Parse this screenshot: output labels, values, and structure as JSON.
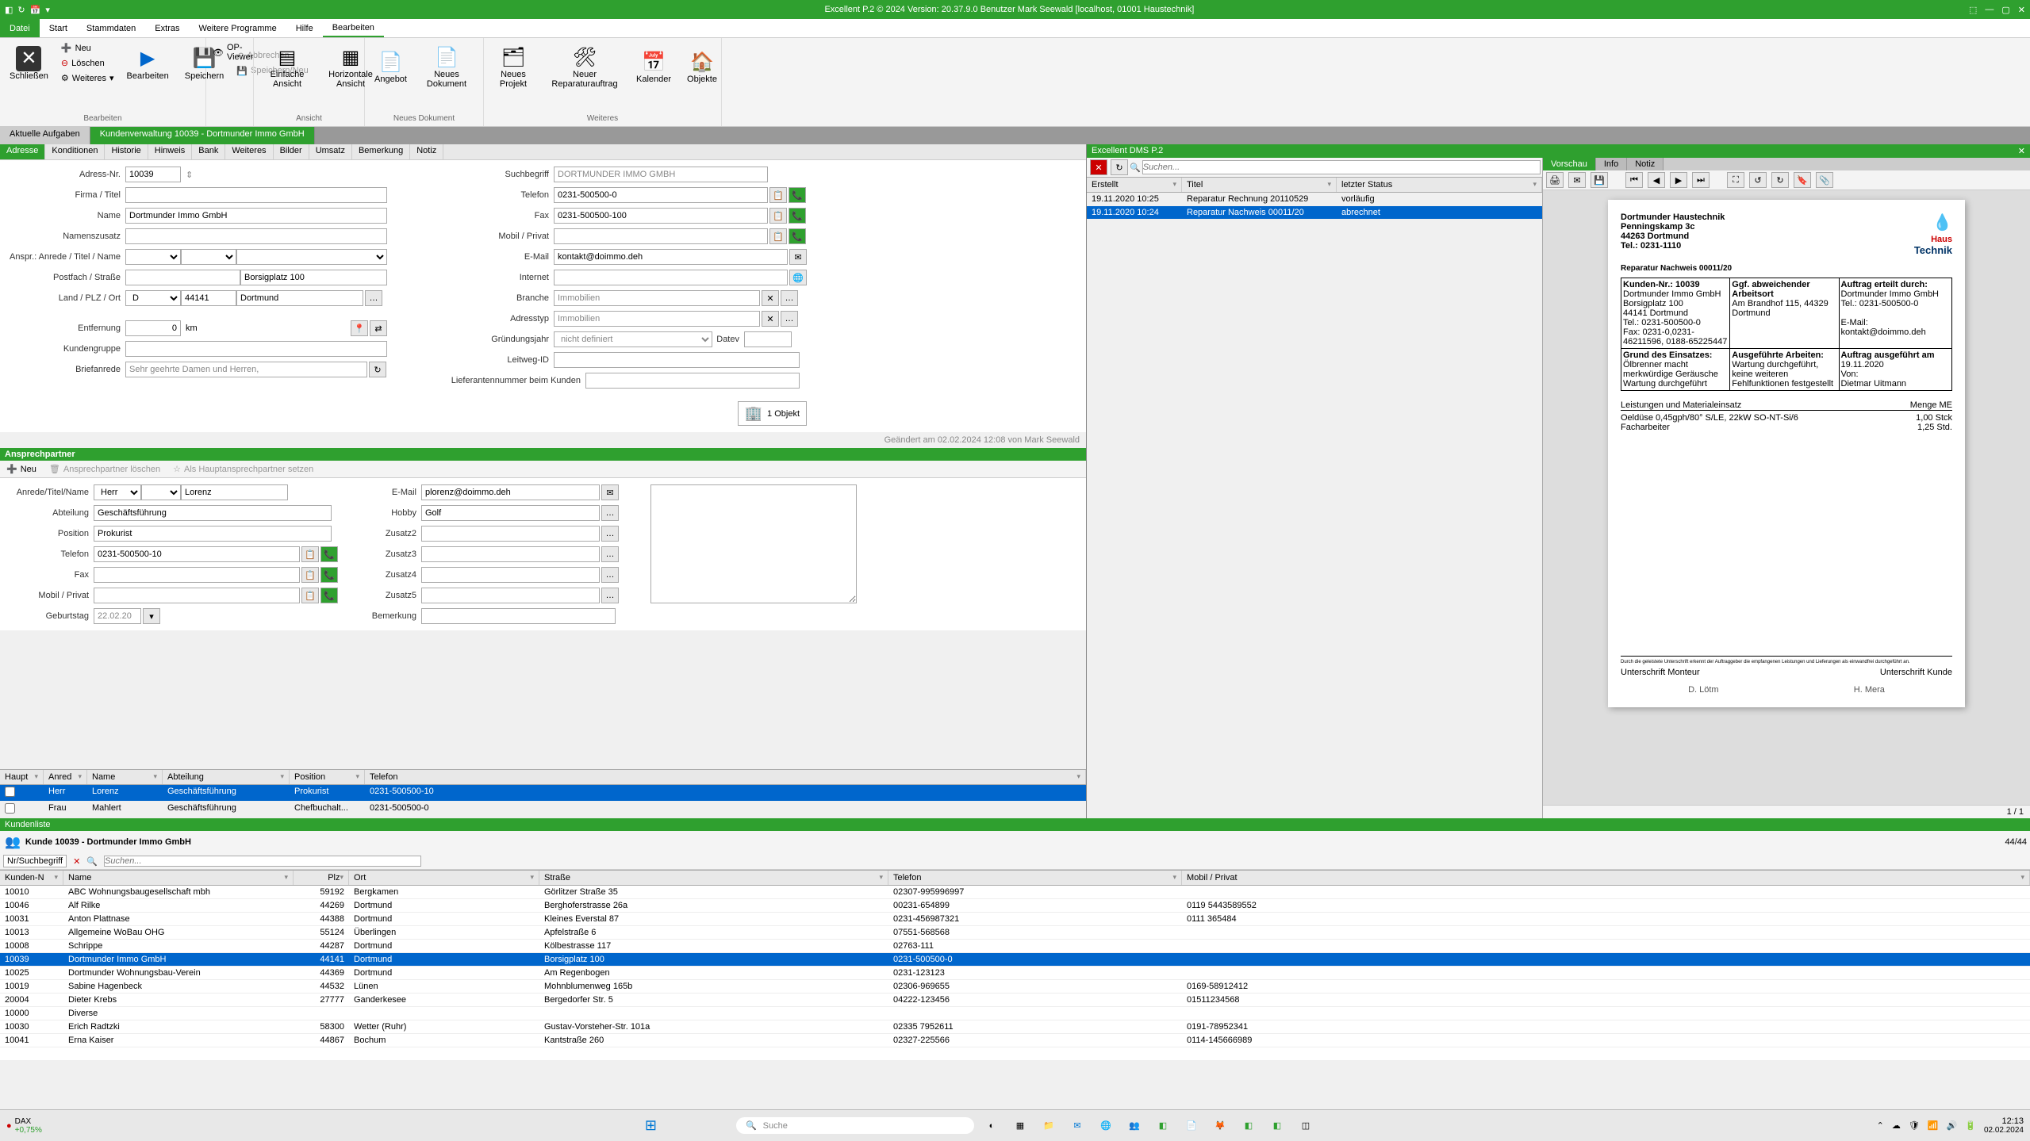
{
  "titlebar": {
    "title": "Excellent P.2 © 2024 Version: 20.37.9.0 Benutzer Mark Seewald [localhost, 01001 Haustechnik]"
  },
  "menu": {
    "datei": "Datei",
    "start": "Start",
    "stammdaten": "Stammdaten",
    "extras": "Extras",
    "weitere_programme": "Weitere Programme",
    "hilfe": "Hilfe",
    "bearbeiten": "Bearbeiten"
  },
  "ribbon": {
    "schliessen": "Schließen",
    "neu": "Neu",
    "loeschen": "Löschen",
    "weiteres": "Weiteres",
    "bearbeiten": "Bearbeiten",
    "speichern": "Speichern",
    "abbrechen": "Abbrechen",
    "speichern_neu": "Speichern/Neu",
    "op_viewer": "OP-Viewer",
    "einfache_ansicht": "Einfache Ansicht",
    "horizontale_ansicht": "Horizontale Ansicht",
    "angebot": "Angebot",
    "neues_dokument": "Neues Dokument",
    "neues_projekt": "Neues Projekt",
    "neuer_reparaturauftrag": "Neuer Reparaturauftrag",
    "kalender": "Kalender",
    "objekte": "Objekte",
    "group_bearbeiten": "Bearbeiten",
    "group_ansicht": "Ansicht",
    "group_neues_dokument": "Neues Dokument",
    "group_weiteres": "Weiteres"
  },
  "doctabs": {
    "aktuelle_aufgaben": "Aktuelle Aufgaben",
    "kundenverwaltung": "Kundenverwaltung 10039 - Dortmunder Immo GmbH"
  },
  "subtabs": {
    "adresse": "Adresse",
    "konditionen": "Konditionen",
    "historie": "Historie",
    "hinweis": "Hinweis",
    "bank": "Bank",
    "weiteres": "Weiteres",
    "bilder": "Bilder",
    "umsatz": "Umsatz",
    "bemerkung": "Bemerkung",
    "notiz": "Notiz"
  },
  "address": {
    "adress_nr_label": "Adress-Nr.",
    "adress_nr": "10039",
    "firma_titel_label": "Firma / Titel",
    "name_label": "Name",
    "name": "Dortmunder Immo GmbH",
    "namenszusatz_label": "Namenszusatz",
    "anspr_label": "Anspr.: Anrede / Titel / Name",
    "postfach_label": "Postfach / Straße",
    "strasse": "Borsigplatz 100",
    "land_plz_ort_label": "Land / PLZ / Ort",
    "land": "D",
    "plz": "44141",
    "ort": "Dortmund",
    "entfernung_label": "Entfernung",
    "entfernung": "0",
    "km": "km",
    "kundengruppe_label": "Kundengruppe",
    "briefanrede_label": "Briefanrede",
    "briefanrede": "Sehr geehrte Damen und Herren,",
    "suchbegriff_label": "Suchbegriff",
    "suchbegriff": "DORTMUNDER IMMO GMBH",
    "telefon_label": "Telefon",
    "telefon": "0231-500500-0",
    "fax_label": "Fax",
    "fax": "0231-500500-100",
    "mobil_label": "Mobil / Privat",
    "email_label": "E-Mail",
    "email": "kontakt@doimmo.deh",
    "internet_label": "Internet",
    "branche_label": "Branche",
    "branche": "Immobilien",
    "adresstyp_label": "Adresstyp",
    "adresstyp": "Immobilien",
    "gruendungsjahr_label": "Gründungsjahr",
    "gruendungsjahr": "nicht definiert",
    "datev_label": "Datev",
    "leitweg_label": "Leitweg-ID",
    "lieferantennr_label": "Lieferantennummer beim Kunden",
    "objekt_count": "1 Objekt",
    "changed": "Geändert am 02.02.2024 12:08 von Mark Seewald"
  },
  "ansprechpartner": {
    "header": "Ansprechpartner",
    "neu": "Neu",
    "loeschen": "Ansprechpartner löschen",
    "haupt": "Als Hauptansprechpartner setzen",
    "anrede_label": "Anrede/Titel/Name",
    "anrede": "Herr",
    "nachname": "Lorenz",
    "abteilung_label": "Abteilung",
    "abteilung": "Geschäftsführung",
    "position_label": "Position",
    "position": "Prokurist",
    "telefon_label": "Telefon",
    "telefon": "0231-500500-10",
    "fax_label": "Fax",
    "mobil_label": "Mobil / Privat",
    "geburtstag_label": "Geburtstag",
    "geburtstag": "22.02.20",
    "email_label": "E-Mail",
    "email": "plorenz@doimmo.deh",
    "hobby_label": "Hobby",
    "hobby": "Golf",
    "zusatz2_label": "Zusatz2",
    "zusatz3_label": "Zusatz3",
    "zusatz4_label": "Zusatz4",
    "zusatz5_label": "Zusatz5",
    "bemerkung_label": "Bemerkung"
  },
  "ap_grid": {
    "h_haupt": "Haupt",
    "h_anrede": "Anred",
    "h_name": "Name",
    "h_abteilung": "Abteilung",
    "h_position": "Position",
    "h_telefon": "Telefon",
    "rows": [
      {
        "anrede": "Herr",
        "name": "Lorenz",
        "abteilung": "Geschäftsführung",
        "position": "Prokurist",
        "telefon": "0231-500500-10"
      },
      {
        "anrede": "Frau",
        "name": "Mahlert",
        "abteilung": "Geschäftsführung",
        "position": "Chefbuchalt...",
        "telefon": "0231-500500-0"
      }
    ]
  },
  "dms": {
    "header": "Excellent DMS P.2",
    "search_placeholder": "Suchen...",
    "h_erstellt": "Erstellt",
    "h_titel": "Titel",
    "h_status": "letzter Status",
    "rows": [
      {
        "erstellt": "19.11.2020 10:25",
        "titel": "Reparatur Rechnung 20110529",
        "status": "vorläufig"
      },
      {
        "erstellt": "19.11.2020 10:24",
        "titel": "Reparatur Nachweis 00011/20",
        "status": "abrechnet"
      }
    ],
    "tab_vorschau": "Vorschau",
    "tab_info": "Info",
    "tab_notiz": "Notiz",
    "page_info": "1 / 1"
  },
  "doc": {
    "firma": "Dortmunder Haustechnik",
    "adresse1": "Penningskamp 3c",
    "adresse2": "44263 Dortmund",
    "tel": "Tel.: 0231-1110",
    "logo": "Haus Technik",
    "title": "Reparatur Nachweis 00011/20",
    "kundennr": "Kunden-Nr.: 10039",
    "auftrag1": "Ggf. abweichender Arbeitsort",
    "auftrag2": "Am Brandhof 115, 44329 Dortmund",
    "auftrag_erteilt": "Auftrag erteilt durch:",
    "auftrag_name": "Dortmunder Immo GmbH",
    "auftrag_tel": "Tel.:     0231-500500-0",
    "box_firma": "Dortmunder Immo GmbH",
    "box_str": "Borsigplatz 100",
    "box_ort": "44141 Dortmund",
    "box_tel": "Tel.: 0231-500500-0",
    "box_kontakt": "E-Mail:    kontakt@doimmo.deh",
    "box_fax": "Fax: 0231-0,0231-46211596, 0188-65225447",
    "grund_h": "Grund des Einsatzes:",
    "grund": "Ölbrenner macht merkwürdige Geräusche Wartung durchgeführt",
    "arbeiten_h": "Ausgeführte Arbeiten:",
    "arbeiten": "Wartung durchgeführt, keine weiteren Fehlfunktionen festgestellt",
    "ausgefuehrt_h": "Auftrag ausgeführt am",
    "ausgefuehrt_date": "19.11.2020",
    "von": "Von:",
    "monteur": "Dietmar Uitmann",
    "leistungen_h": "Leistungen und Materialeinsatz",
    "menge_h": "Menge ME",
    "pos1": "Oeldüse 0,45gph/80° S/LE, 22kW SO-NT-Si/6",
    "pos1_m": "1,00 Stck",
    "pos2": "Facharbeiter",
    "pos2_m": "1,25 Std.",
    "sig_text": "Durch die geleistete Unterschrift erkennt der Auftraggeber die empfangenen Leistungen und Lieferungen als einwandfrei durchgeführt an.",
    "sig_monteur": "Unterschrift Monteur",
    "sig_kunde": "Unterschrift Kunde"
  },
  "kundenliste": {
    "header": "Kundenliste",
    "title": "Kunde 10039 - Dortmunder Immo GmbH",
    "count": "44/44",
    "search_label": "Nr/Suchbegriff",
    "search_placeholder": "Suchen...",
    "h_kundennr": "Kunden-N",
    "h_name": "Name",
    "h_plz": "Plz",
    "h_ort": "Ort",
    "h_strasse": "Straße",
    "h_telefon": "Telefon",
    "h_mobil": "Mobil / Privat",
    "rows": [
      {
        "nr": "10010",
        "name": "ABC Wohnungsbaugesellschaft mbh",
        "plz": "59192",
        "ort": "Bergkamen",
        "strasse": "Görlitzer Straße 35",
        "tel": "02307-995996997",
        "mobil": ""
      },
      {
        "nr": "10046",
        "name": "Alf Rilke",
        "plz": "44269",
        "ort": "Dortmund",
        "strasse": "Berghoferstrasse 26a",
        "tel": "00231-654899",
        "mobil": "0119 5443589552"
      },
      {
        "nr": "10031",
        "name": "Anton Plattnase",
        "plz": "44388",
        "ort": "Dortmund",
        "strasse": "Kleines Everstal 87",
        "tel": "0231-456987321",
        "mobil": "0111 365484"
      },
      {
        "nr": "10013",
        "name": "Allgemeine WoBau OHG",
        "plz": "55124",
        "ort": "Überlingen",
        "strasse": "Apfelstraße 6",
        "tel": "07551-568568",
        "mobil": ""
      },
      {
        "nr": "10008",
        "name": "Schrippe",
        "plz": "44287",
        "ort": "Dortmund",
        "strasse": "Kölbestrasse 117",
        "tel": "02763-111",
        "mobil": ""
      },
      {
        "nr": "10039",
        "name": "Dortmunder Immo GmbH",
        "plz": "44141",
        "ort": "Dortmund",
        "strasse": "Borsigplatz 100",
        "tel": "0231-500500-0",
        "mobil": ""
      },
      {
        "nr": "10025",
        "name": "Dortmunder Wohnungsbau-Verein",
        "plz": "44369",
        "ort": "Dortmund",
        "strasse": "Am Regenbogen",
        "tel": "0231-123123",
        "mobil": ""
      },
      {
        "nr": "10019",
        "name": "Sabine Hagenbeck",
        "plz": "44532",
        "ort": "Lünen",
        "strasse": "Mohnblumenweg 165b",
        "tel": "02306-969655",
        "mobil": "0169-58912412"
      },
      {
        "nr": "20004",
        "name": "Dieter Krebs",
        "plz": "27777",
        "ort": "Ganderkesee",
        "strasse": "Bergedorfer Str. 5",
        "tel": "04222-123456",
        "mobil": "01511234568"
      },
      {
        "nr": "10000",
        "name": "Diverse",
        "plz": "",
        "ort": "",
        "strasse": "",
        "tel": "",
        "mobil": ""
      },
      {
        "nr": "10030",
        "name": "Erich Radtzki",
        "plz": "58300",
        "ort": "Wetter (Ruhr)",
        "strasse": "Gustav-Vorsteher-Str. 101a",
        "tel": "02335 7952611",
        "mobil": "0191-78952341"
      },
      {
        "nr": "10041",
        "name": "Erna Kaiser",
        "plz": "44867",
        "ort": "Bochum",
        "strasse": "Kantstraße 260",
        "tel": "02327-225566",
        "mobil": "0114-145666989"
      }
    ]
  },
  "taskbar": {
    "dax": "DAX",
    "dax_pct": "+0,75%",
    "search_placeholder": "Suche",
    "time": "12:13",
    "date": "02.02.2024"
  }
}
